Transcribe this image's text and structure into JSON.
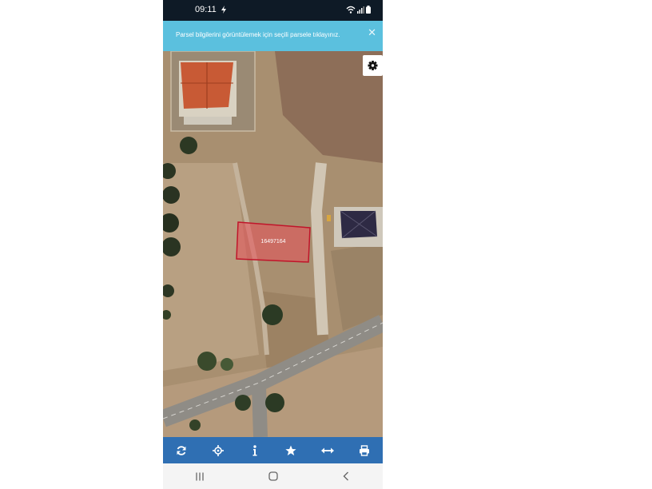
{
  "status_bar": {
    "time": "09:11"
  },
  "banner": {
    "message": "Parsel bilgilerini görüntülemek için seçili parsele tıklayınız.",
    "close_glyph": "✕"
  },
  "map": {
    "parcel_label": "16497164",
    "parcel_color": "#c0152a"
  },
  "toolbar": {
    "icons": [
      "refresh-icon",
      "locate-crosshair-icon",
      "info-icon",
      "star-icon",
      "measure-arrows-icon",
      "print-icon"
    ]
  },
  "nav": {
    "buttons": [
      "recent-apps",
      "home",
      "back"
    ]
  },
  "colors": {
    "banner": "#5bc0de",
    "toolbar": "#2f6fb3",
    "status_bar": "#0e1a26"
  }
}
